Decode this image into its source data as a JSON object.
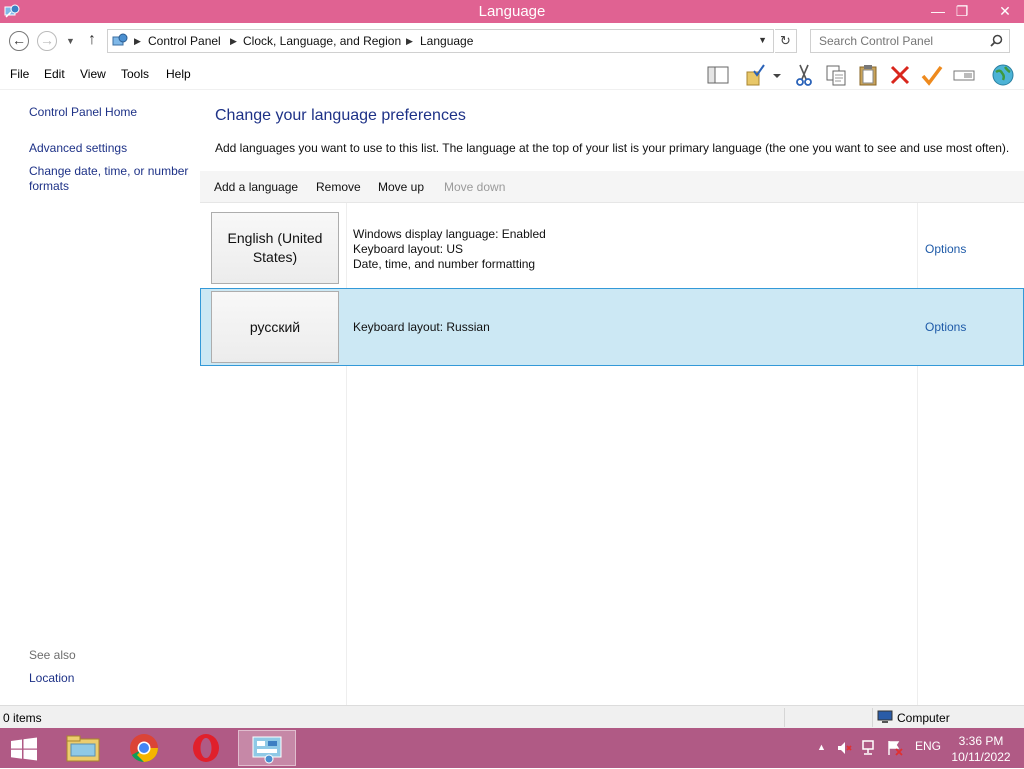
{
  "window": {
    "title": "Language",
    "minimize_glyph": "—",
    "maximize_glyph": "❐",
    "close_glyph": "✕"
  },
  "address": {
    "breadcrumbs": [
      "Control Panel",
      "Clock, Language, and Region",
      "Language"
    ],
    "search_placeholder": "Search Control Panel"
  },
  "menu": [
    "File",
    "Edit",
    "View",
    "Tools",
    "Help"
  ],
  "toolbar_icons": [
    "preview-pane-icon",
    "properties-icon",
    "cut-icon",
    "copy-icon",
    "paste-icon",
    "delete-icon",
    "checkmark-icon",
    "rename-icon",
    "globe-icon"
  ],
  "nav": {
    "home": "Control Panel Home",
    "advanced": "Advanced settings",
    "datetime_line1": "Change date, time, or number",
    "datetime_line2": "formats",
    "see_also": "See also",
    "location": "Location"
  },
  "main": {
    "heading": "Change your language preferences",
    "description": "Add languages you want to use to this list. The language at the top of your list is your primary language (the one you want to see and use most often).",
    "commands": {
      "add": "Add a language",
      "remove": "Remove",
      "move_up": "Move up",
      "move_down": "Move down"
    },
    "languages": [
      {
        "name_line1": "English (United",
        "name_line2": "States)",
        "details": [
          "Windows display language: Enabled",
          "Keyboard layout: US",
          "Date, time, and number formatting"
        ],
        "options": "Options"
      },
      {
        "name_line1": "русский",
        "details": [
          "Keyboard layout: Russian"
        ],
        "options": "Options"
      }
    ]
  },
  "status": {
    "items": "0 items",
    "location": "Computer"
  },
  "taskbar": {
    "language": "ENG",
    "time": "3:36 PM",
    "date": "10/11/2022"
  },
  "colors": {
    "titlebar": "#e06292",
    "taskbar": "#b05a85",
    "link": "#1e3287",
    "selection": "#cce8f4",
    "selection_border": "#3399d8"
  }
}
